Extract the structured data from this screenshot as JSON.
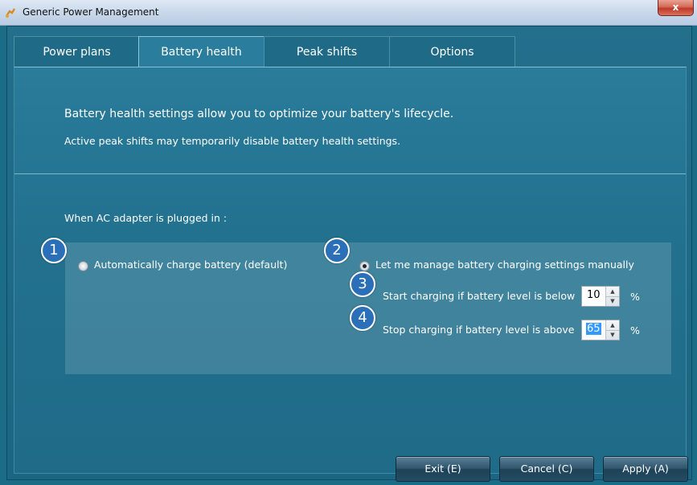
{
  "window": {
    "title": "Generic Power Management",
    "close_label": "x"
  },
  "tabs": [
    {
      "label": "Power plans",
      "active": false
    },
    {
      "label": "Battery health",
      "active": true
    },
    {
      "label": "Peak shifts",
      "active": false
    },
    {
      "label": "Options",
      "active": false
    }
  ],
  "battery": {
    "description": "Battery health settings allow you to optimize your battery's lifecycle.",
    "note": "Active peak shifts may temporarily disable battery health settings.",
    "ac_label": "When AC adapter is plugged in :",
    "option_auto": {
      "badge": "1",
      "label": "Automatically charge battery (default)",
      "checked": false
    },
    "option_manual": {
      "badge": "2",
      "label": "Let me manage battery charging settings manually",
      "checked": true
    },
    "start": {
      "badge": "3",
      "label": "Start charging if battery level is below",
      "value": "10",
      "unit": "%"
    },
    "stop": {
      "badge": "4",
      "label": "Stop charging if battery level is above",
      "value": "65",
      "unit": "%"
    }
  },
  "buttons": {
    "exit": "Exit (E)",
    "cancel": "Cancel (C)",
    "apply": "Apply (A)"
  },
  "colors": {
    "background": "#1b6c87",
    "badge": "#2b6fb8",
    "selection": "#3399ff"
  }
}
